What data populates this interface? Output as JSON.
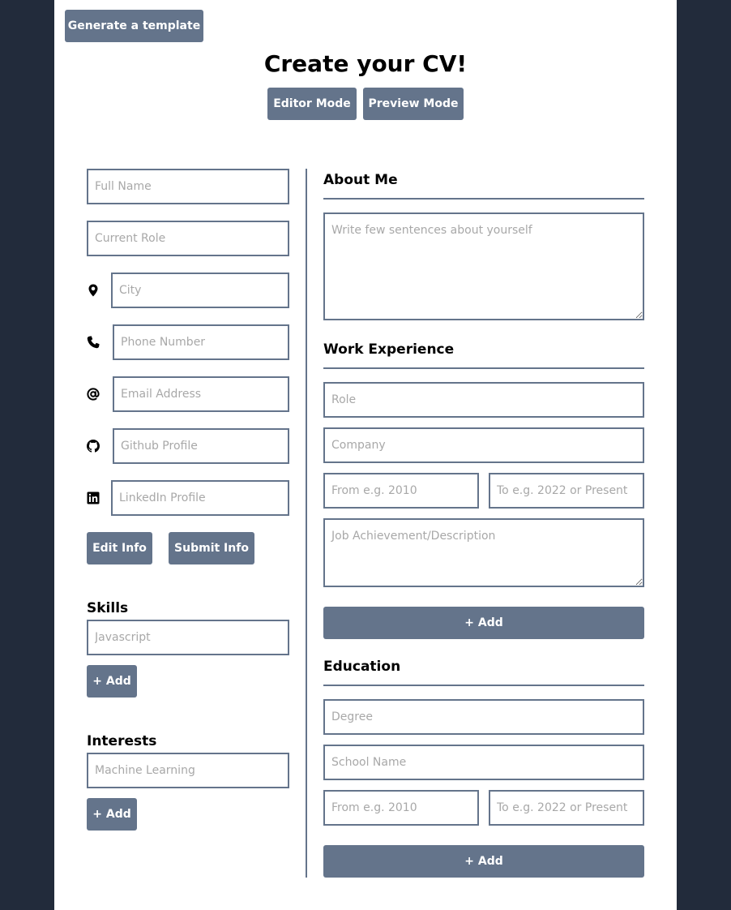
{
  "toolbar": {
    "template_button": "Generate a template"
  },
  "header": {
    "title": "Create your CV!",
    "editor_mode": "Editor Mode",
    "preview_mode": "Preview Mode"
  },
  "personal": {
    "full_name_placeholder": "Full Name",
    "role_placeholder": "Current Role",
    "city_placeholder": "City",
    "phone_placeholder": "Phone Number",
    "email_placeholder": "Email Address",
    "github_placeholder": "Github Profile",
    "linkedin_placeholder": "LinkedIn Profile",
    "edit_button": "Edit Info",
    "submit_button": "Submit Info",
    "icons": [
      "location-pin-icon",
      "phone-icon",
      "at-sign-icon",
      "github-icon",
      "linkedin-icon"
    ]
  },
  "skills": {
    "heading": "Skills",
    "placeholder": "Javascript",
    "add_button": "+ Add"
  },
  "interests": {
    "heading": "Interests",
    "placeholder": "Machine Learning",
    "add_button": "+ Add"
  },
  "about": {
    "heading": "About Me",
    "placeholder": "Write few sentences about yourself"
  },
  "work": {
    "heading": "Work Experience",
    "role_placeholder": "Role",
    "company_placeholder": "Company",
    "from_placeholder": "From e.g. 2010",
    "to_placeholder": "To e.g. 2022 or Present",
    "description_placeholder": "Job Achievement/Description",
    "add_button": "+ Add"
  },
  "education": {
    "heading": "Education",
    "degree_placeholder": "Degree",
    "school_placeholder": "School Name",
    "from_placeholder": "From e.g. 2010",
    "to_placeholder": "To e.g. 2022 or Present",
    "add_button": "+ Add"
  },
  "colors": {
    "background": "#222b3b",
    "accent": "#64748b",
    "page": "#ffffff"
  }
}
